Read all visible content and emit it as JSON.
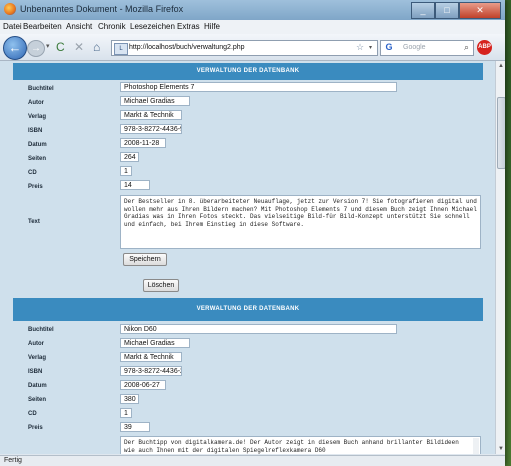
{
  "window": {
    "title": "Unbenanntes Dokument - Mozilla Firefox",
    "minimize": "_",
    "maximize": "□",
    "close": "✕"
  },
  "menu": [
    "Datei",
    "Bearbeiten",
    "Ansicht",
    "Chronik",
    "Lesezeichen",
    "Extras",
    "Hilfe"
  ],
  "nav": {
    "back_icon": "back-arrow-icon",
    "back_glyph": "←",
    "forward_glyph": "→",
    "history_dropdown": "▾",
    "reload_glyph": "C",
    "stop_glyph": "✕",
    "home_glyph": "⌂",
    "url": "http://localhost/buch/verwaltung2.php",
    "search_placeholder": "Google",
    "search_engine_glyph": "G",
    "star_glyph": "☆",
    "url_dropdown": "▾",
    "search_glyph": "⌕",
    "addon_label": "ABP"
  },
  "section_header": "VERWALTUNG DER DATENBANK",
  "labels": {
    "buchtitel": "Buchtitel",
    "autor": "Autor",
    "verlag": "Verlag",
    "isbn": "ISBN",
    "datum": "Datum",
    "seiten": "Seiten",
    "cd": "CD",
    "preis": "Preis",
    "text": "Text"
  },
  "records": [
    {
      "buchtitel": "Photoshop Elements 7",
      "autor": "Michael Gradias",
      "verlag": "Markt & Technik",
      "isbn": "978-3-8272-4436-9",
      "datum": "2008-11-28",
      "seiten": "264",
      "cd": "1",
      "preis": "14",
      "text": "Der Bestseller in 8. überarbeiteter Neuauflage, jetzt zur Version 7! Sie fotografieren digital und wollen mehr aus Ihren Bildern machen? Mit Photoshop Elements 7 und diesem Buch zeigt Ihnen Michael Gradias was in Ihren Fotos steckt. Das vielseitige Bild-für Bild-Konzept unterstützt Sie schnell und einfach, bei Ihrem Einstieg in diese Software.",
      "save": "Speichern",
      "delete": "Löschen"
    },
    {
      "buchtitel": "Nikon D60",
      "autor": "Michael Gradias",
      "verlag": "Markt & Technik",
      "isbn": "978-3-8272-4436-2",
      "datum": "2008-06-27",
      "seiten": "380",
      "cd": "1",
      "preis": "39",
      "text": "Der Buchtipp von digitalkamera.de! Der Autor zeigt in diesem Buch anhand brillanter Bildideen wie auch Ihnen mit der digitalen Spiegelreflexkamera D60"
    }
  ],
  "status": "Fertig"
}
